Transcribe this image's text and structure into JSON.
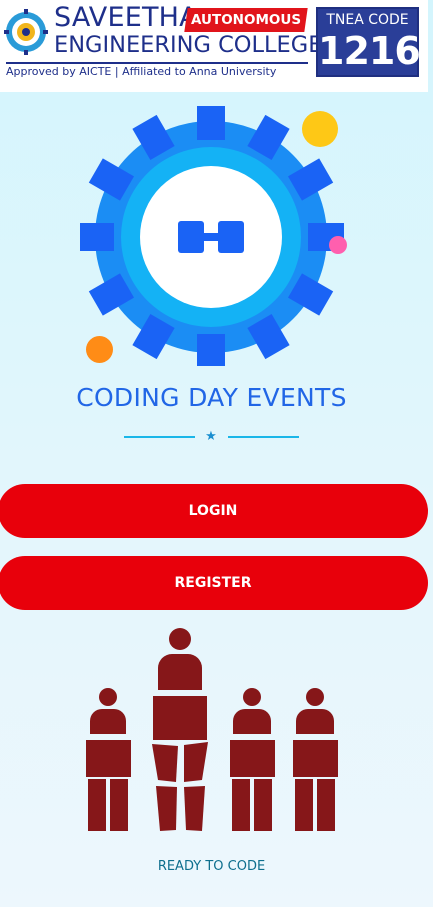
{
  "banner": {
    "college_name_line1": "SAVEETHA",
    "college_name_line2": "ENGINEERING COLLEGE",
    "autonomous_badge": "AUTONOMOUS",
    "approval_text": "Approved by AICTE  |  Affiliated to Anna University",
    "tnea_label": "TNEA CODE",
    "tnea_code": "1216"
  },
  "logo": {
    "icon": "coding-gear-icon",
    "gear_outer_color": "#1b8df4",
    "gear_tooth_color": "#1a63f5",
    "ring_color": "#14b2f5",
    "center_color": "#ffffff",
    "symbol_color": "#1a63f5"
  },
  "decor_dots": {
    "yellow": "#fec816",
    "pink": "#ff5fae",
    "orange": "#ff8c16"
  },
  "title": "CODING DAY EVENTS",
  "divider_icon": "star-icon",
  "buttons": {
    "login": "LOGIN",
    "register": "REGISTER",
    "color": "#e8000b"
  },
  "illustration": {
    "icon": "people-figures-icon",
    "color": "#861719"
  },
  "tagline": "READY TO CODE"
}
